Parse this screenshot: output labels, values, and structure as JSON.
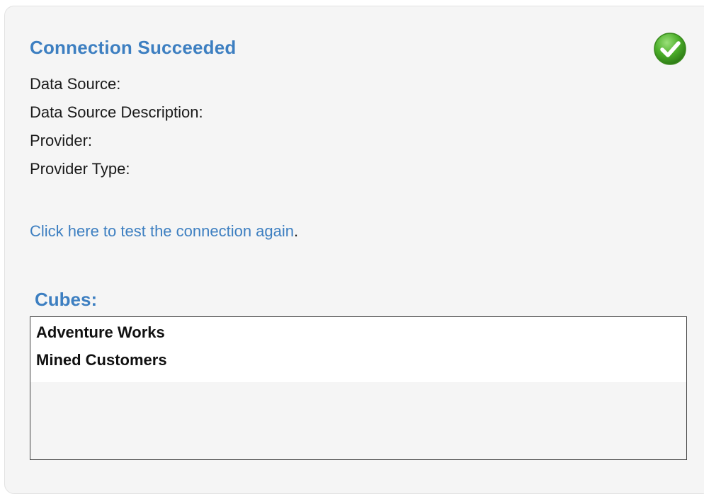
{
  "connection": {
    "title": "Connection Succeeded",
    "status_icon": "check-circle-icon",
    "status_color": "#4caf2a",
    "fields": [
      {
        "label": "Data Source:",
        "value": ""
      },
      {
        "label": "Data Source Description:",
        "value": ""
      },
      {
        "label": "Provider:",
        "value": ""
      },
      {
        "label": "Provider Type:",
        "value": ""
      }
    ],
    "retest_link": "Click here to test the connection again",
    "retest_suffix": "."
  },
  "cubes": {
    "label": "Cubes:",
    "items": [
      "Adventure Works",
      "Mined Customers"
    ]
  },
  "colors": {
    "accent": "#3d7fc1",
    "panel_bg": "#f5f5f5"
  }
}
